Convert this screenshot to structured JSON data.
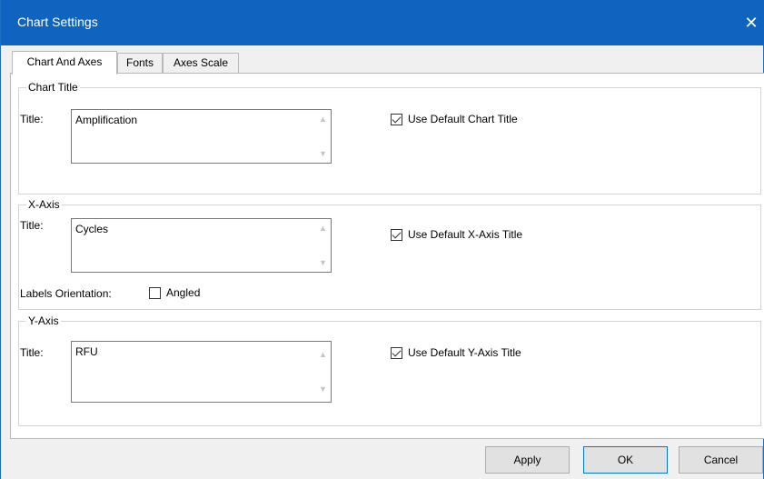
{
  "window": {
    "title": "Chart Settings",
    "close_glyph": "✕"
  },
  "tabs": [
    {
      "label": "Chart And Axes",
      "active": true
    },
    {
      "label": "Fonts",
      "active": false
    },
    {
      "label": "Axes Scale",
      "active": false
    }
  ],
  "chart_title": {
    "group_label": "Chart Title",
    "title_label": "Title:",
    "title_value": "Amplification",
    "use_default_label": "Use Default Chart Title",
    "use_default_checked": true
  },
  "x_axis": {
    "group_label": "X-Axis",
    "title_label": "Title:",
    "title_value": "Cycles",
    "use_default_label": "Use Default X-Axis Title",
    "use_default_checked": true,
    "labels_orientation_label": "Labels Orientation:",
    "angled_label": "Angled",
    "angled_checked": false
  },
  "y_axis": {
    "group_label": "Y-Axis",
    "title_label": "Title:",
    "title_value": "RFU",
    "use_default_label": "Use Default Y-Axis Title",
    "use_default_checked": true
  },
  "buttons": {
    "apply": "Apply",
    "ok": "OK",
    "cancel": "Cancel"
  },
  "icons": {
    "close": "close-icon",
    "scroll_up": "chevron-up-icon",
    "scroll_down": "chevron-down-icon",
    "checkmark": "checkmark-icon"
  },
  "colors": {
    "titlebar": "#0e64bf",
    "panel": "#ffffff",
    "dialog": "#f0f0f0",
    "default_button_border": "#0078d7"
  }
}
